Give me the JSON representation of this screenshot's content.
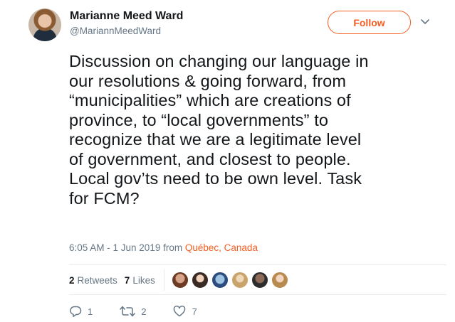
{
  "author": {
    "name": "Marianne Meed Ward",
    "handle": "@MariannMeedWard"
  },
  "follow_button": {
    "label": "Follow"
  },
  "tweet": {
    "lines": [
      "Discussion on changing our language in",
      "our resolutions & going forward, from",
      "“municipalities” which are creations of",
      "province, to “local governments” to",
      "recognize that we are a legitimate level",
      "of government, and closest to people.",
      "Local gov’ts need to be own level. Task",
      "for FCM?"
    ]
  },
  "meta": {
    "time": "6:05 AM - 1 Jun 2019",
    "from": "from",
    "place": "Québec, Canada"
  },
  "stats": {
    "retweets_count": "2",
    "retweets_label": "Retweets",
    "likes_count": "7",
    "likes_label": "Likes"
  },
  "actions": {
    "reply_count": "1",
    "retweet_count": "2",
    "like_count": "7"
  },
  "colors": {
    "accent": "#f45d22",
    "muted": "#657786",
    "text": "#14171a"
  },
  "icons": [
    "caret-down-icon",
    "reply-icon",
    "retweet-icon",
    "heart-icon"
  ]
}
